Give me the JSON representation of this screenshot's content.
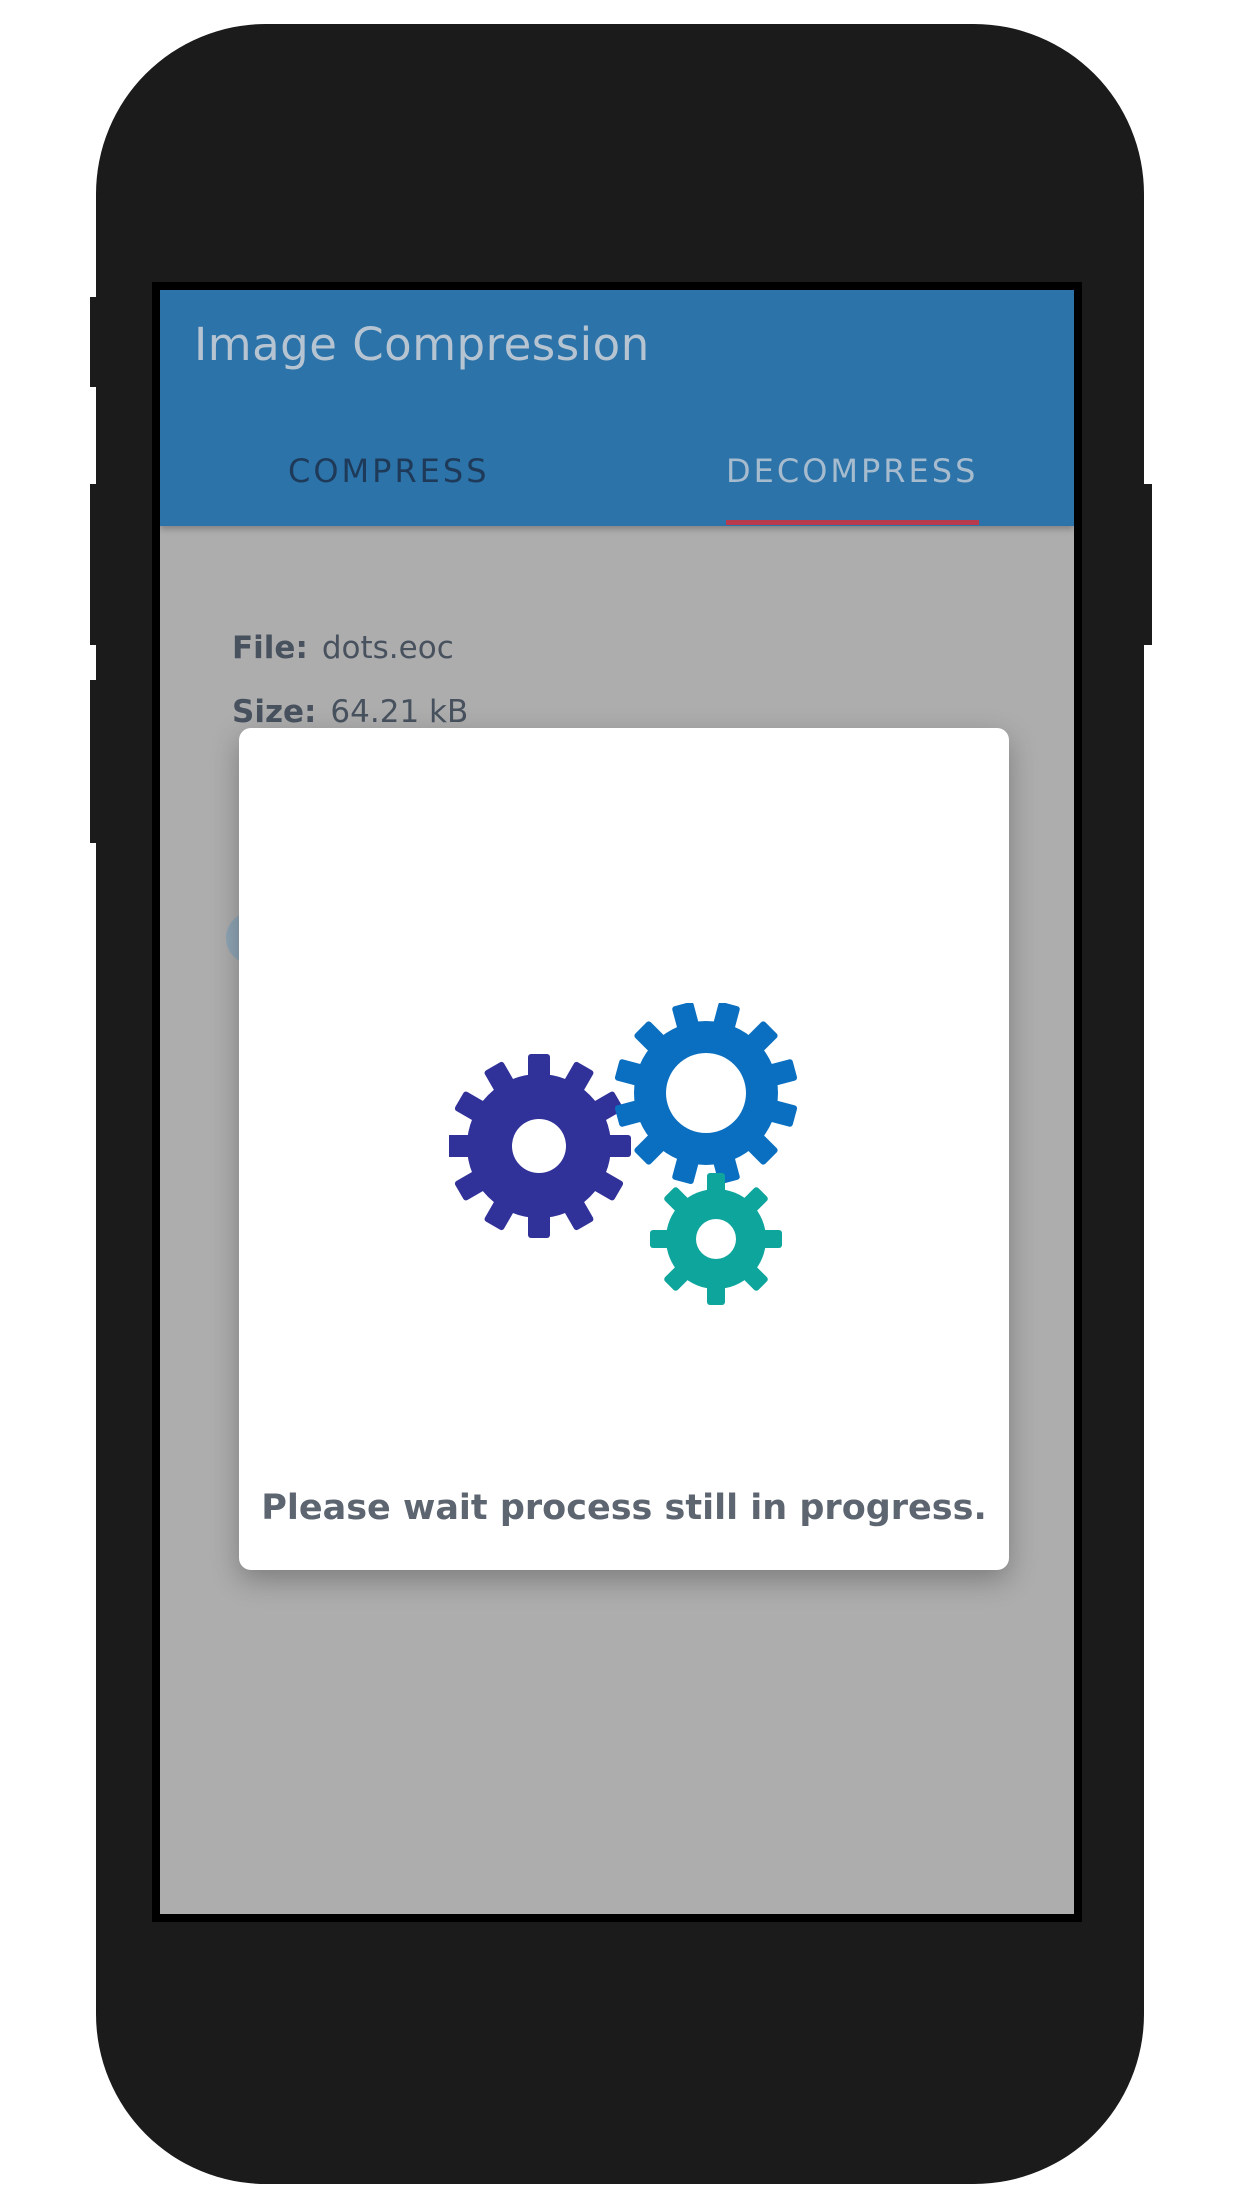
{
  "app": {
    "title": "Image Compression"
  },
  "tabs": [
    {
      "label": "COMPRESS",
      "active": false
    },
    {
      "label": "DECOMPRESS",
      "active": true
    }
  ],
  "file_info": {
    "file_label": "File:",
    "file_value": "dots.eoc",
    "size_label": "Size:",
    "size_value": "64.21 kB"
  },
  "dialog": {
    "message": "Please wait process still in progress.",
    "icon": "gears-icon"
  },
  "colors": {
    "appbar": "#2b73a9",
    "tab_indicator": "#b83a4d",
    "gear_left": "#31319a",
    "gear_top": "#0a6fc0",
    "gear_small": "#0ea59c"
  }
}
